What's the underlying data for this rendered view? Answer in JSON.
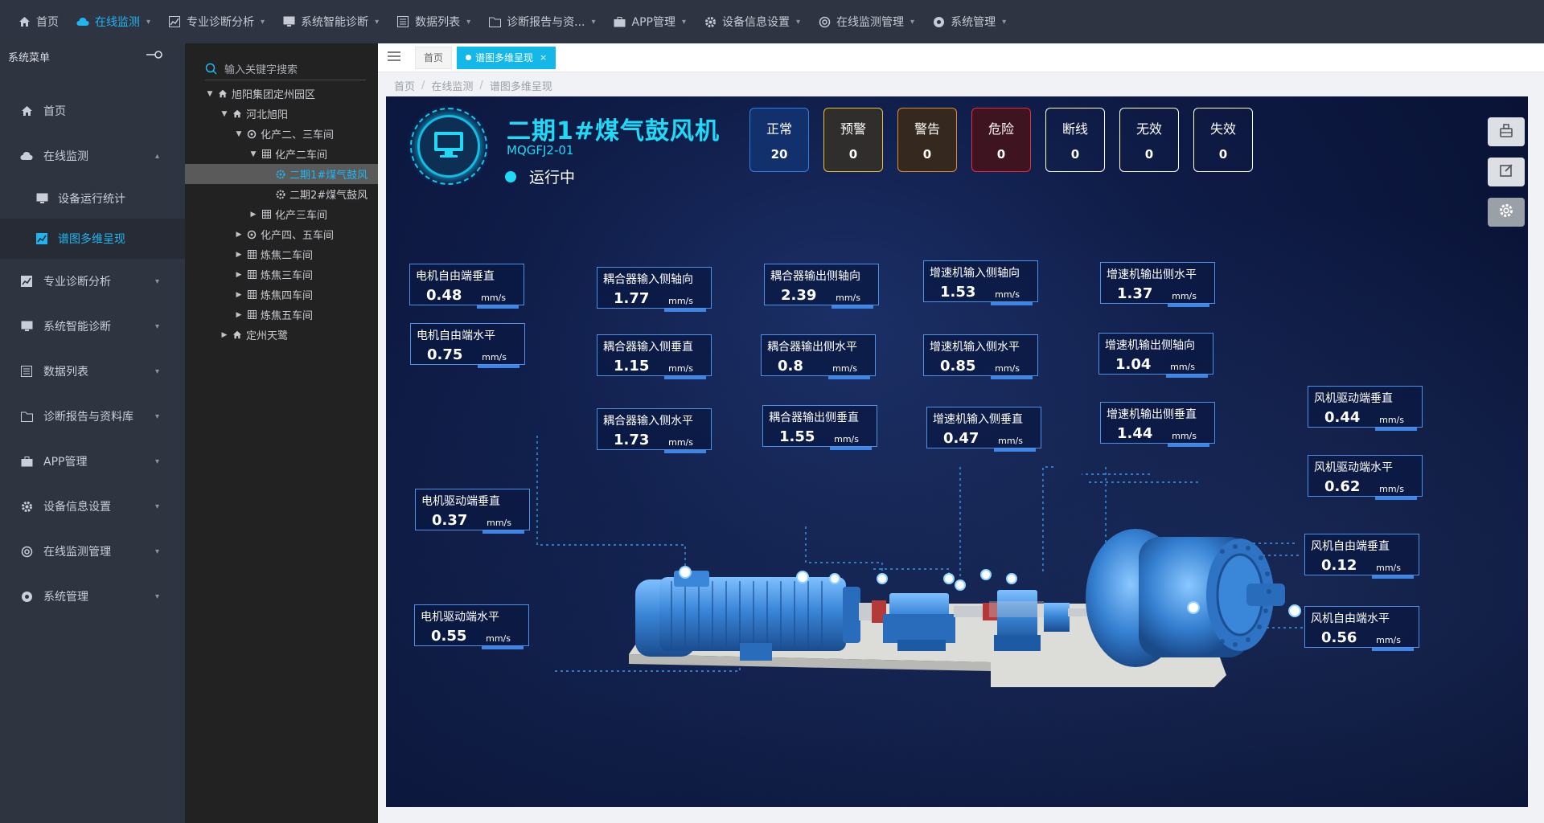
{
  "topnav": {
    "items": [
      {
        "label": "首页",
        "icon": "home-icon"
      },
      {
        "label": "在线监测",
        "icon": "cloud-icon",
        "active": true
      },
      {
        "label": "专业诊断分析",
        "icon": "chart-icon"
      },
      {
        "label": "系统智能诊断",
        "icon": "monitor-icon"
      },
      {
        "label": "数据列表",
        "icon": "list-icon"
      },
      {
        "label": "诊断报告与资...",
        "icon": "folder-icon"
      },
      {
        "label": "APP管理",
        "icon": "briefcase-icon"
      },
      {
        "label": "设备信息设置",
        "icon": "gear-icon"
      },
      {
        "label": "在线监测管理",
        "icon": "settings-icon"
      },
      {
        "label": "系统管理",
        "icon": "cog-icon"
      }
    ]
  },
  "sidebar": {
    "title": "系统菜单",
    "items": [
      {
        "label": "首页"
      },
      {
        "label": "在线监测"
      },
      {
        "label": "设备运行统计"
      },
      {
        "label": "谱图多维呈现"
      },
      {
        "label": "专业诊断分析"
      },
      {
        "label": "系统智能诊断"
      },
      {
        "label": "数据列表"
      },
      {
        "label": "诊断报告与资料库"
      },
      {
        "label": "APP管理"
      },
      {
        "label": "设备信息设置"
      },
      {
        "label": "在线监测管理"
      },
      {
        "label": "系统管理"
      }
    ]
  },
  "tree": {
    "search_placeholder": "输入关键字搜索",
    "nodes": [
      {
        "label": "旭阳集团定州园区"
      },
      {
        "label": "河北旭阳"
      },
      {
        "label": "化产二、三车间"
      },
      {
        "label": "化产二车间"
      },
      {
        "label": "二期1#煤气鼓风"
      },
      {
        "label": "二期2#煤气鼓风"
      },
      {
        "label": "化产三车间"
      },
      {
        "label": "化产四、五车间"
      },
      {
        "label": "炼焦二车间"
      },
      {
        "label": "炼焦三车间"
      },
      {
        "label": "炼焦四车间"
      },
      {
        "label": "炼焦五车间"
      },
      {
        "label": "定州天鹭"
      }
    ]
  },
  "tabs": {
    "home": "首页",
    "active": "谱图多维呈现",
    "close": "×"
  },
  "breadcrumb": [
    "首页",
    "在线监测",
    "谱图多维呈现"
  ],
  "device": {
    "title": "二期1#煤气鼓风机",
    "code": "MQGFJ2-01",
    "state": "运行中"
  },
  "status": [
    {
      "label": "正常",
      "count": "20",
      "border": "#2f7fe0",
      "bg": "#12306c"
    },
    {
      "label": "预警",
      "count": "0",
      "border": "#e6c23c",
      "bg": "#2f2e2c"
    },
    {
      "label": "警告",
      "count": "0",
      "border": "#e08a30",
      "bg": "#35291f"
    },
    {
      "label": "危险",
      "count": "0",
      "border": "#e02e3c",
      "bg": "#3d1420"
    },
    {
      "label": "断线",
      "count": "0",
      "border": "#ffffff",
      "bg": "transparent"
    },
    {
      "label": "无效",
      "count": "0",
      "border": "#ffffff",
      "bg": "transparent"
    },
    {
      "label": "失效",
      "count": "0",
      "border": "#ffffff",
      "bg": "transparent"
    }
  ],
  "unit": "mm/s",
  "measurements": [
    {
      "name": "电机自由端垂直",
      "value": "0.48"
    },
    {
      "name": "电机自由端水平",
      "value": "0.75"
    },
    {
      "name": "电机驱动端垂直",
      "value": "0.37"
    },
    {
      "name": "电机驱动端水平",
      "value": "0.55"
    },
    {
      "name": "耦合器输入侧轴向",
      "value": "1.77"
    },
    {
      "name": "耦合器输入侧垂直",
      "value": "1.15"
    },
    {
      "name": "耦合器输入侧水平",
      "value": "1.73"
    },
    {
      "name": "耦合器输出侧轴向",
      "value": "2.39"
    },
    {
      "name": "耦合器输出侧水平",
      "value": "0.8"
    },
    {
      "name": "耦合器输出侧垂直",
      "value": "1.55"
    },
    {
      "name": "增速机输入侧轴向",
      "value": "1.53"
    },
    {
      "name": "增速机输入侧水平",
      "value": "0.85"
    },
    {
      "name": "增速机输入侧垂直",
      "value": "0.47"
    },
    {
      "name": "增速机输出侧水平",
      "value": "1.37"
    },
    {
      "name": "增速机输出侧轴向",
      "value": "1.04"
    },
    {
      "name": "增速机输出侧垂直",
      "value": "1.44"
    },
    {
      "name": "风机驱动端垂直",
      "value": "0.44"
    },
    {
      "name": "风机驱动端水平",
      "value": "0.62"
    },
    {
      "name": "风机自由端垂直",
      "value": "0.12"
    },
    {
      "name": "风机自由端水平",
      "value": "0.56"
    }
  ],
  "side_buttons": [
    {
      "icon": "robot-icon"
    },
    {
      "icon": "edit-icon"
    },
    {
      "icon": "gear-icon"
    }
  ]
}
